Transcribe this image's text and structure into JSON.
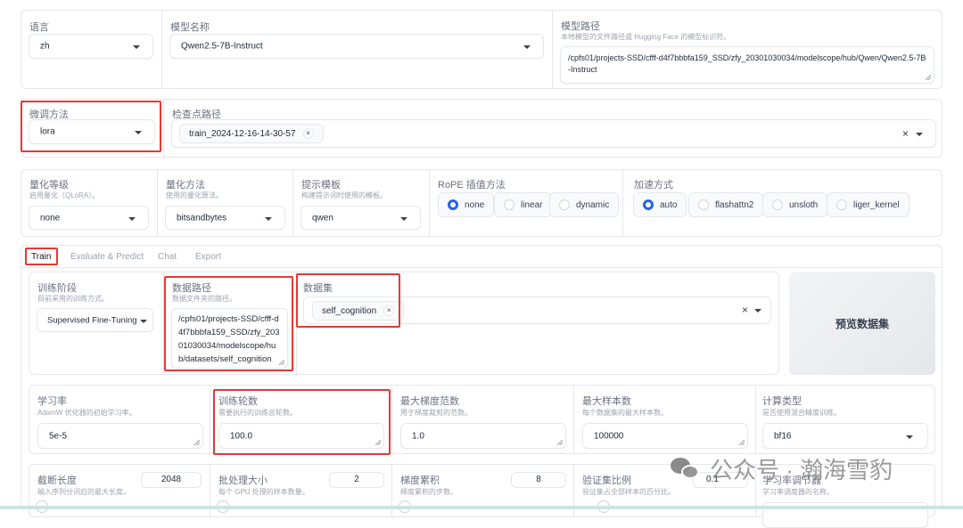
{
  "top_row": {
    "language": {
      "label": "语言",
      "value": "zh"
    },
    "model_name": {
      "label": "模型名称",
      "value": "Qwen2.5-7B-Instruct"
    },
    "model_path": {
      "label": "模型路径",
      "hint": "本地模型的文件路径或 Hugging Face 的模型标识符。",
      "value": "/cpfs01/projects-SSD/cfff-d4f7bbbfa159_SSD/zfy_20301030034/modelscope/hub/Qwen/Qwen2.5-7B-Instruct"
    }
  },
  "second_row": {
    "finetune_method": {
      "label": "微调方法",
      "value": "lora"
    },
    "checkpoint_path": {
      "label": "检查点路径",
      "chips": [
        "train_2024-12-16-14-30-57"
      ],
      "chip_remove": "×",
      "clear": "×"
    }
  },
  "third_row": {
    "quant_bit": {
      "label": "量化等级",
      "hint": "启用量化（QLoRA）。",
      "value": "none"
    },
    "quant_method": {
      "label": "量化方法",
      "hint": "使用的量化算法。",
      "value": "bitsandbytes"
    },
    "template": {
      "label": "提示模板",
      "hint": "构建提示词时使用的模板。",
      "value": "qwen"
    },
    "rope_scaling": {
      "label": "RoPE 插值方法",
      "options": [
        "none",
        "linear",
        "dynamic"
      ],
      "selected": "none"
    },
    "booster": {
      "label": "加速方式",
      "options": [
        "auto",
        "flashattn2",
        "unsloth",
        "liger_kernel"
      ],
      "selected": "auto"
    }
  },
  "tabs": [
    {
      "label": "Train",
      "active": true
    },
    {
      "label": "Evaluate & Predict",
      "active": false
    },
    {
      "label": "Chat",
      "active": false
    },
    {
      "label": "Export",
      "active": false
    }
  ],
  "train": {
    "stage": {
      "label": "训练阶段",
      "hint": "目前采用的训练方式。",
      "value": "Supervised Fine-Tuning"
    },
    "dataset_dir": {
      "label": "数据路径",
      "hint": "数据文件夹的路径。",
      "value": "/cpfs01/projects-SSD/cfff-d4f7bbbfa159_SSD/zfy_20301030034/modelscope/hub/datasets/self_cognition"
    },
    "dataset": {
      "label": "数据集",
      "chips": [
        "self_cognition"
      ],
      "chip_remove": "×",
      "clear": "×"
    },
    "preview_button": "预览数据集",
    "learning_rate": {
      "label": "学习率",
      "hint": "AdamW 优化器的初始学习率。",
      "value": "5e-5"
    },
    "num_epochs": {
      "label": "训练轮数",
      "hint": "需要执行的训练总轮数。",
      "value": "100.0"
    },
    "max_grad_norm": {
      "label": "最大梯度范数",
      "hint": "用于梯度裁剪的范数。",
      "value": "1.0"
    },
    "max_samples": {
      "label": "最大样本数",
      "hint": "每个数据集的最大样本数。",
      "value": "100000"
    },
    "compute_type": {
      "label": "计算类型",
      "hint": "是否使用混合精度训练。",
      "value": "bf16"
    },
    "cutoff_len": {
      "label": "截断长度",
      "hint": "输入序列分词后的最大长度。",
      "value": "2048",
      "slider_fraction": 0.0
    },
    "batch_size": {
      "label": "批处理大小",
      "hint": "每个 GPU 处理的样本数量。",
      "value": "2",
      "slider_fraction": 0.0
    },
    "grad_accum": {
      "label": "梯度累积",
      "hint": "梯度累积的步数。",
      "value": "8",
      "slider_fraction": 0.0
    },
    "val_size": {
      "label": "验证集比例",
      "hint": "验证集占全部样本的百分比。",
      "value": "0.1",
      "slider_fraction": 0.1
    },
    "lr_scheduler": {
      "label": "学习率调节器",
      "hint": "学习率调度器的名称。"
    }
  },
  "watermark": "公众号 · 瀚海雪豹",
  "colors": {
    "accent": "#2563eb",
    "highlight": "#e53935"
  }
}
